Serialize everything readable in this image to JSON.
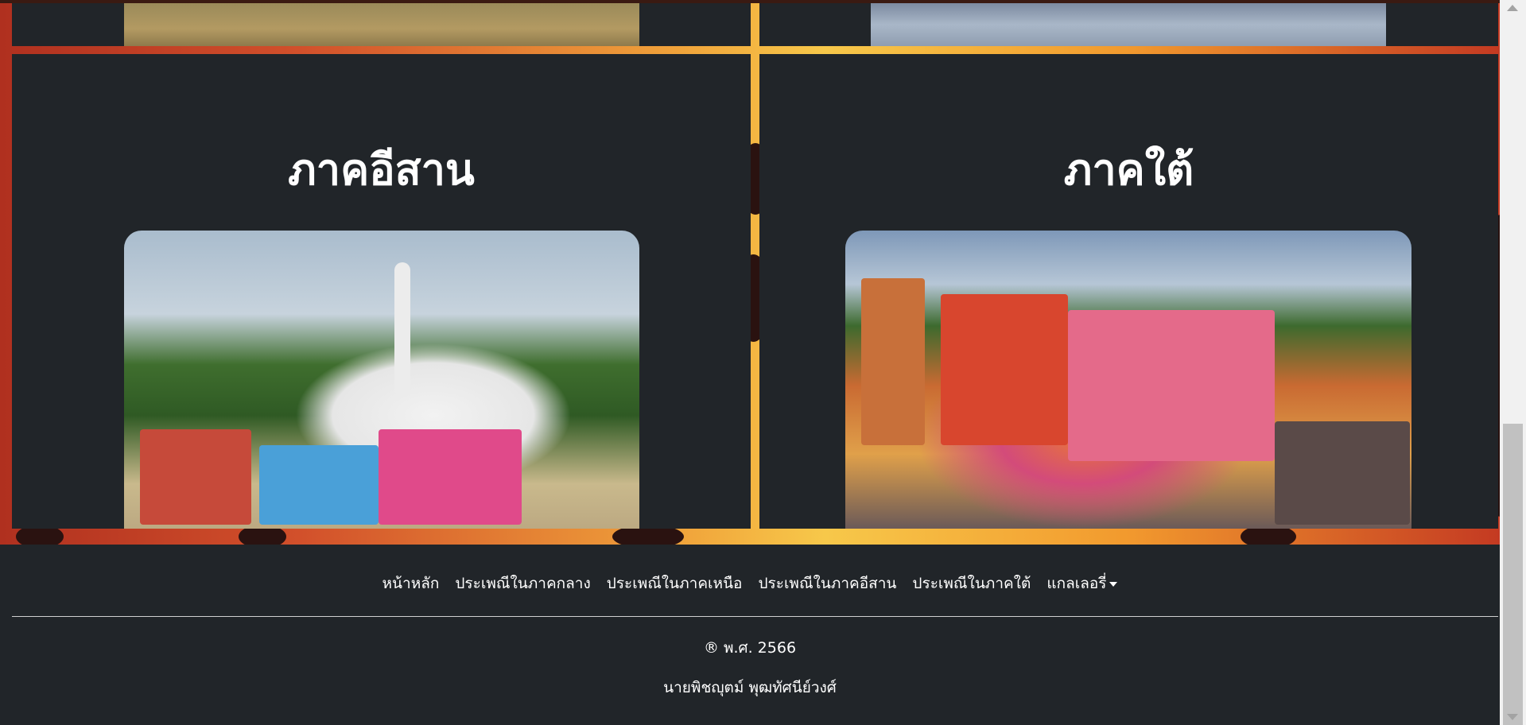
{
  "sections": {
    "northeast": {
      "title": "ภาคอีสาน"
    },
    "south": {
      "title": "ภาคใต้"
    }
  },
  "footer": {
    "nav": [
      {
        "label": "หน้าหลัก"
      },
      {
        "label": "ประเพณีในภาคกลาง"
      },
      {
        "label": "ประเพณีในภาคเหนือ"
      },
      {
        "label": "ประเพณีในภาคอีสาน"
      },
      {
        "label": "ประเพณีในภาคใต้"
      },
      {
        "label": "แกลเลอรี่"
      }
    ],
    "copyright": "® พ.ศ. 2566",
    "author": "นายพิชญุตม์ พุฒทัศนีย์วงศ์"
  },
  "colors": {
    "background": "#212529",
    "accent_gold": "#f7c84a",
    "accent_red": "#b0301f"
  }
}
